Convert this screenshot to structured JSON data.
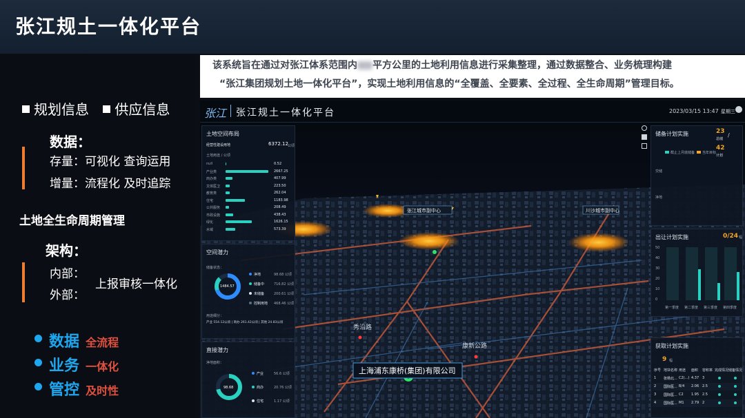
{
  "page": {
    "title": "张江规土一体化平台"
  },
  "intro": {
    "line1_a": "该系统旨在通过对张江体系范围内",
    "line1_b": "平方公里的土地利用信息进行采集整理，通过数据整合、业务梳理构建",
    "line2": "“张江集团规划土地一体化平台”，实现土地利用信息的“全覆盖、全要素、全过程、全生命周期”管理目标。"
  },
  "left": {
    "tag1": "规划信息",
    "tag2": "供应信息",
    "data_heading": "数据：",
    "stock": "存量：可视化  查询运用",
    "increment": "增量：流程化  及时追踪",
    "lifecycle": "土地全生命周期管理",
    "arch_heading": "架构：",
    "internal": "内部：",
    "external": "外部：",
    "unify": "上报审核一体化",
    "bullets": [
      {
        "main": "数据",
        "sub": "全流程"
      },
      {
        "main": "业务",
        "sub": "一体化"
      },
      {
        "main": "管控",
        "sub": "及时性"
      }
    ]
  },
  "dashboard": {
    "logo": "张江",
    "title": "张江规土一体化平台",
    "datetime": "2023/03/15  13:47",
    "weekday": "星期三",
    "land_panel": {
      "title": "土地空间布局",
      "total_label": "经营性建设用地",
      "total_value": "6372.12",
      "unit": "公顷",
      "subtitle": "土地用途 / 公顷",
      "rows": [
        {
          "name": "null",
          "value": "0.52",
          "pct": 0.01
        },
        {
          "name": "产业类",
          "value": "2667.25",
          "pct": 1.0
        },
        {
          "name": "商办类",
          "value": "407.99",
          "pct": 0.16
        },
        {
          "name": "文体医卫",
          "value": "223.50",
          "pct": 0.09
        },
        {
          "name": "教育类",
          "value": "262.04",
          "pct": 0.1
        },
        {
          "name": "住宅",
          "value": "1183.98",
          "pct": 0.45
        },
        {
          "name": "公共服务",
          "value": "208.49",
          "pct": 0.08
        },
        {
          "name": "市政设施",
          "value": "438.43",
          "pct": 0.17
        },
        {
          "name": "绿化",
          "value": "1626.15",
          "pct": 0.61
        },
        {
          "name": "水域",
          "value": "573.39",
          "pct": 0.22
        }
      ]
    },
    "space_panel": {
      "title": "空间潜力",
      "subtitle": "储备状态：",
      "center": "1484.57",
      "legend": [
        {
          "name": "净地",
          "value": "98.68 公顷",
          "color": "#2f8cff"
        },
        {
          "name": "储备中",
          "value": "716.82 公顷",
          "color": "#2ad1c0"
        },
        {
          "name": "未储备",
          "value": "200.61 公顷",
          "color": "#dfe6ee"
        },
        {
          "name": "控制用地",
          "value": "468.46 公顷",
          "color": "#5a6f86"
        }
      ],
      "footer_title": "用途细分：",
      "footer": "产业 554.12公顷 | 商办 261.42公顷 | 其他 24.83公顷"
    },
    "supply_panel": {
      "title": "直接潜力",
      "subtitle": "净地面积：",
      "center": "98.68",
      "legend": [
        {
          "name": "产业",
          "value": "56.6 公顷",
          "color": "#2f8cff"
        },
        {
          "name": "商办",
          "value": "20.76 公顷",
          "color": "#2ad1c0"
        },
        {
          "name": "住宅",
          "value": "1.17 公顷",
          "color": "#dfe6ee"
        }
      ]
    },
    "reserve_panel": {
      "title": "储备计划实施",
      "count_a": "23",
      "count_a_label": "总储",
      "count_b": "42",
      "count_b_label": "计划",
      "legend_a": "截止上月底储备",
      "legend_b": "当年目标",
      "axis_a": "交储",
      "axis_b": "净地"
    },
    "transfer_panel": {
      "title": "出让计划实施",
      "progress": "0/24",
      "unit": "幅",
      "yticks": [
        "50",
        "40",
        "30",
        "20",
        "10",
        "0"
      ],
      "categories": [
        "第一季度",
        "第二季度",
        "第三季度",
        "第四季度"
      ]
    },
    "acquire_panel": {
      "title": "获取计划实施",
      "count": "9",
      "unit": "幅",
      "headers": [
        "序号",
        "地块名称",
        "用途",
        "面积",
        "容积率",
        "完成情况",
        "储备情况"
      ],
      "rows": [
        [
          "1",
          "张杨北...",
          "C2(...)",
          "4.37",
          "3"
        ],
        [
          "2",
          "国际医...",
          "B/4",
          "2.06",
          "2.5"
        ],
        [
          "3",
          "国际医...",
          "C2",
          "1.95",
          "2.5"
        ],
        [
          "4",
          "国际医...",
          "M1",
          "2.79",
          "2"
        ]
      ]
    },
    "map": {
      "labels": [
        "张江城市副中心",
        "川沙城市副中心",
        "秀沿路",
        "康新公路"
      ],
      "company": "上海浦东康桥(集团)有限公司"
    }
  }
}
